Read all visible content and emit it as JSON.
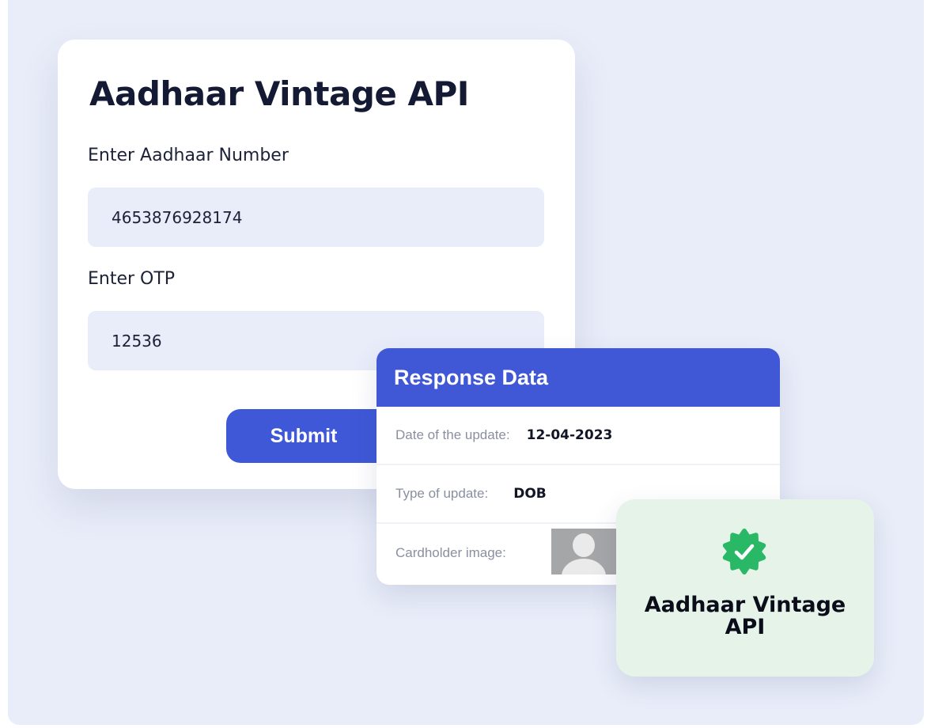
{
  "form": {
    "title": "Aadhaar Vintage API",
    "aadhaar_label": "Enter Aadhaar Number",
    "aadhaar_value": "4653876928174",
    "otp_label": "Enter OTP",
    "otp_value": "12536",
    "submit_label": "Submit"
  },
  "response": {
    "title": "Response Data",
    "rows": [
      {
        "key": "Date of the update:",
        "value": "12-04-2023"
      },
      {
        "key": "Type of update:",
        "value": "DOB"
      },
      {
        "key": "Cardholder image:",
        "value": ""
      }
    ]
  },
  "success": {
    "title": "Aadhaar Vintage API",
    "icon": "verified-check-icon"
  },
  "colors": {
    "background": "#e9edf9",
    "accent": "#3e58d7",
    "success_card": "#e6f3e9",
    "success_icon": "#29b865"
  }
}
